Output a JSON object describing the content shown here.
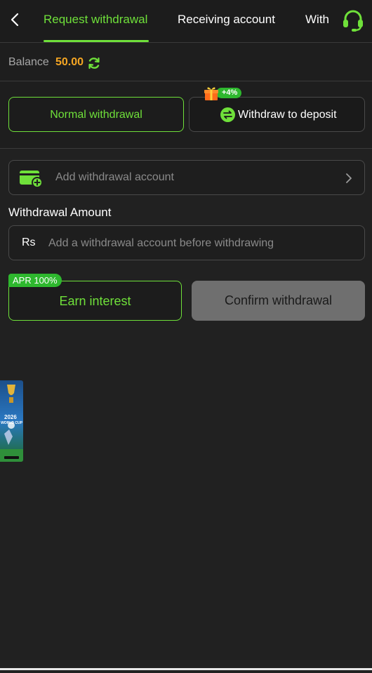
{
  "header": {
    "tabs": [
      {
        "label": "Request withdrawal",
        "active": true
      },
      {
        "label": "Receiving account",
        "active": false
      },
      {
        "label": "With",
        "active": false
      }
    ]
  },
  "balance": {
    "label": "Balance",
    "value": "50.00"
  },
  "methods": {
    "normal_label": "Normal withdrawal",
    "deposit_label": "Withdraw to deposit",
    "bonus_badge": "+4%"
  },
  "account": {
    "placeholder": "Add withdrawal account"
  },
  "amount": {
    "title": "Withdrawal Amount",
    "currency": "Rs",
    "placeholder": "Add a withdrawal account before withdrawing"
  },
  "actions": {
    "apr_badge": "APR 100%",
    "earn_label": "Earn interest",
    "confirm_label": "Confirm withdrawal"
  },
  "promo": {
    "year_text": "2026",
    "event_text": "WORLD CUP"
  },
  "colors": {
    "accent": "#6fe03a",
    "balance": "#f5a623",
    "badge": "#2eb82e",
    "disabled": "#6f6f6f"
  }
}
